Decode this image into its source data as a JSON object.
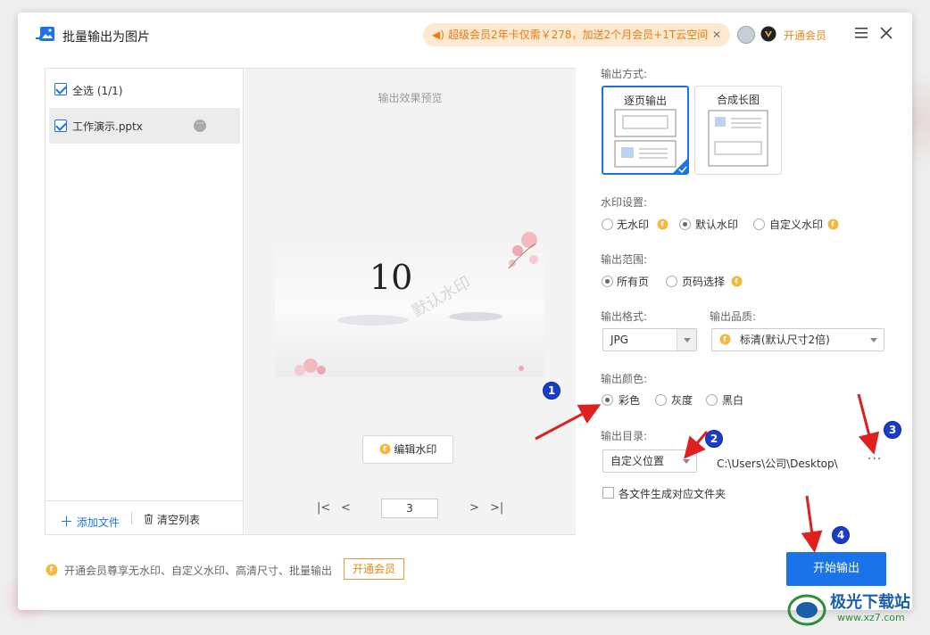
{
  "window": {
    "title": "批量输出为图片"
  },
  "promo": {
    "text": "超级会员2年卡仅需￥278，加送2个月会员+1T云空间",
    "close": "✕"
  },
  "header": {
    "vip_label": "开通会员"
  },
  "file_list": {
    "select_all": "全选 (1/1)",
    "items": [
      {
        "name": "工作演示.pptx",
        "more": "···"
      }
    ],
    "add_file": "添加文件",
    "clear_list": "清空列表"
  },
  "preview": {
    "label": "输出效果预览",
    "slide_number": "10",
    "slide_watermark": "默认水印",
    "edit_watermark": "编辑水印",
    "page": "3"
  },
  "settings": {
    "output_mode": {
      "label": "输出方式:",
      "options": [
        "逐页输出",
        "合成长图"
      ],
      "selected": "逐页输出"
    },
    "watermark": {
      "label": "水印设置:",
      "options": [
        "无水印",
        "默认水印",
        "自定义水印"
      ],
      "selected": "默认水印"
    },
    "range": {
      "label": "输出范围:",
      "options": [
        "所有页",
        "页码选择"
      ],
      "selected": "所有页"
    },
    "format": {
      "label": "输出格式:",
      "value": "JPG"
    },
    "quality": {
      "label": "输出品质:",
      "value": "标清(默认尺寸2倍)"
    },
    "color": {
      "label": "输出颜色:",
      "options": [
        "彩色",
        "灰度",
        "黑白"
      ],
      "selected": "彩色"
    },
    "directory": {
      "label": "输出目录:",
      "mode": "自定义位置",
      "path": "C:\\Users\\公司\\Desktop\\",
      "browse": "···"
    },
    "per_file_folder": "各文件生成对应文件夹"
  },
  "footer": {
    "vip_text": "开通会员尊享无水印、自定义水印、高清尺寸、批量输出",
    "vip_button": "开通会员",
    "start_button": "开始输出"
  },
  "annotations": [
    "1",
    "2",
    "3",
    "4"
  ],
  "site_watermark": {
    "name": "极光下载站",
    "url": "www.xz7.com"
  },
  "colors": {
    "accent": "#1a73e8",
    "vip": "#e08a16",
    "promo_bg": "#fde9cf",
    "annotation_arrow": "#e02020"
  }
}
